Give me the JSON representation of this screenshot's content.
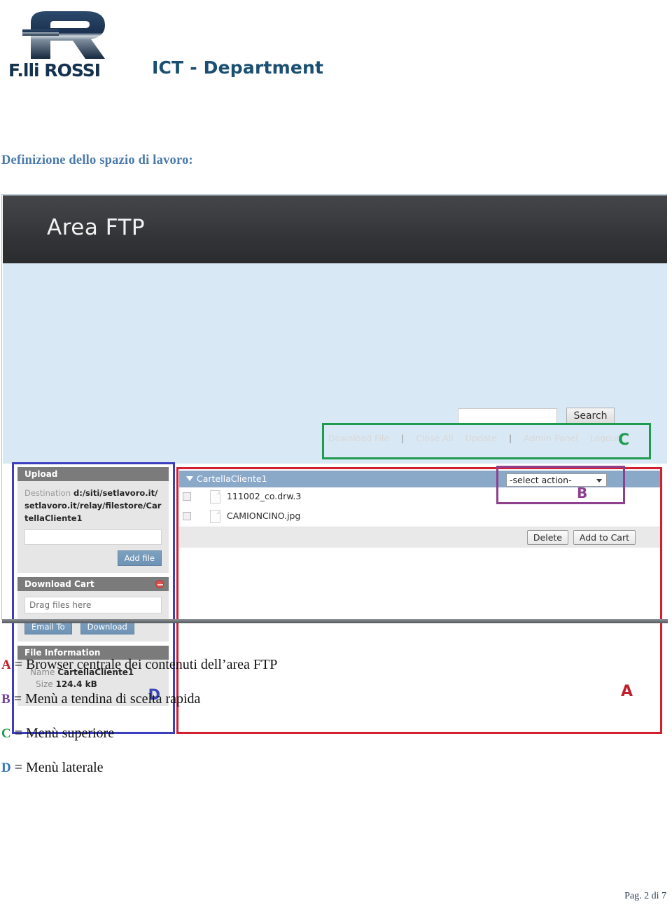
{
  "header": {
    "logo_word": "F.lli ROSSI",
    "department": "ICT - Department"
  },
  "section": {
    "title": "Definizione dello spazio di lavoro:"
  },
  "screenshot": {
    "app_title": "Area FTP",
    "search": {
      "value": "",
      "placeholder": "",
      "button_label": "Search"
    },
    "top_menu": {
      "items": [
        "Download File",
        "Close All",
        "Update",
        "Admin Panel",
        "Logout"
      ],
      "separator": "|"
    },
    "sidebar": {
      "upload": {
        "title": "Upload",
        "destination_label": "Destination",
        "destination_path": "d:/siti/setlavoro.it/setlavoro.it/relay/filestore/CartellaCliente1",
        "file_input_value": "",
        "add_file_label": "Add file"
      },
      "download_cart": {
        "title": "Download Cart",
        "drop_text": "Drag files here",
        "email_label": "Email To",
        "download_label": "Download",
        "remove_icon": "minus-circle-icon"
      },
      "file_information": {
        "title": "File Information",
        "name_label": "Name",
        "name_value": "CartellaCliente1",
        "size_label": "Size",
        "size_value": "124.4 kB"
      }
    },
    "browser": {
      "folder_name": "CartellaCliente1",
      "folder_caret": "caret-down-icon",
      "files": [
        {
          "name": "111002_co.drw.3",
          "checked": false
        },
        {
          "name": "CAMIONCINO.jpg",
          "checked": false
        }
      ],
      "delete_label": "Delete",
      "add_to_cart_label": "Add to Cart"
    },
    "select_action": {
      "value": "-select action-",
      "arrow_icon": "chevron-down-icon"
    },
    "annotations": [
      {
        "key": "A",
        "color": "#c0202c"
      },
      {
        "key": "B",
        "color": "#8e3f8e"
      },
      {
        "key": "C",
        "color": "#1f9b4f"
      },
      {
        "key": "D",
        "color": "#3b46b5"
      }
    ]
  },
  "legend": {
    "rows": [
      {
        "key": "A",
        "eq": "=",
        "text": "Browser centrale dei contenuti dell’area FTP"
      },
      {
        "key": "B",
        "eq": "=",
        "text": "Menù a tendina di scelta rapida"
      },
      {
        "key": "C",
        "eq": "=",
        "text": "Menù superiore"
      },
      {
        "key": "D",
        "eq": "=",
        "text": "Menù laterale"
      }
    ]
  },
  "footer": {
    "page_label": "Pag. 2 di 7"
  }
}
